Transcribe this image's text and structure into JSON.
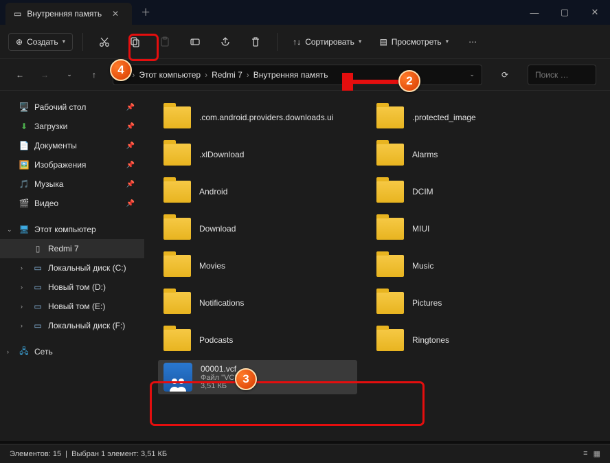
{
  "tab": {
    "title": "Внутренняя память"
  },
  "toolbar": {
    "new_label": "Создать",
    "sort_label": "Сортировать",
    "view_label": "Просмотреть"
  },
  "breadcrumb": {
    "parts": [
      "Этот компьютер",
      "Redmi 7",
      "Внутренняя память"
    ]
  },
  "search": {
    "placeholder": "Поиск …"
  },
  "sidebar": {
    "quick": [
      {
        "label": "Рабочий стол",
        "icon": "🖥️",
        "color": "#3da9e0"
      },
      {
        "label": "Загрузки",
        "icon": "⬇",
        "color": "#4db04d"
      },
      {
        "label": "Документы",
        "icon": "📄",
        "color": "#c0c0c0"
      },
      {
        "label": "Изображения",
        "icon": "🖼️",
        "color": "#3da9e0"
      },
      {
        "label": "Музыка",
        "icon": "🎵",
        "color": "#d8427a"
      },
      {
        "label": "Видео",
        "icon": "🎬",
        "color": "#8a40c8"
      }
    ],
    "this_pc": "Этот компьютер",
    "device": "Redmi 7",
    "drives": [
      "Локальный диск (C:)",
      "Новый том (D:)",
      "Новый том (E:)",
      "Локальный диск (F:)"
    ],
    "network": "Сеть"
  },
  "folders": [
    ".com.android.providers.downloads.ui",
    ".protected_image",
    ".xlDownload",
    "Alarms",
    "Android",
    "DCIM",
    "Download",
    "MIUI",
    "Movies",
    "Music",
    "Notifications",
    "Pictures",
    "Podcasts",
    "Ringtones"
  ],
  "file": {
    "name": "00001.vcf",
    "type": "Файл \"VCF\"",
    "size": "3,51 КБ"
  },
  "status": {
    "count_label": "Элементов: 15",
    "selected_label": "Выбран 1 элемент: 3,51 КБ"
  },
  "annot": {
    "b2": "2",
    "b3": "3",
    "b4": "4"
  }
}
